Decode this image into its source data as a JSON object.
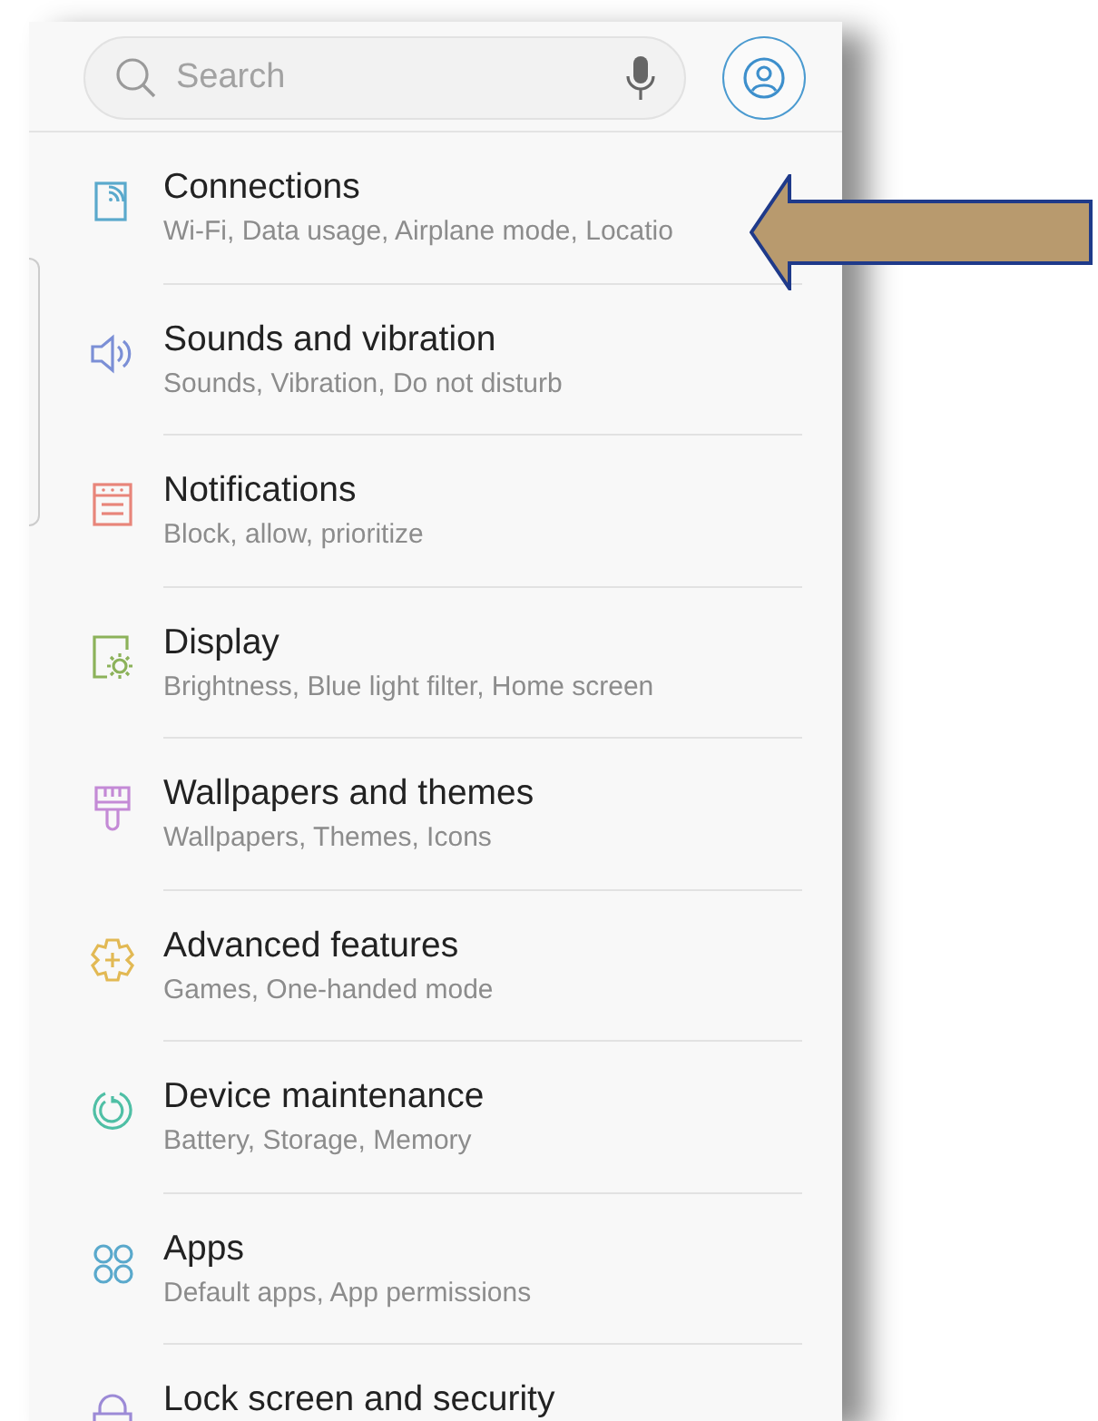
{
  "search": {
    "placeholder": "Search"
  },
  "items": [
    {
      "title": "Connections",
      "subtitle": "Wi-Fi, Data usage, Airplane mode, Locatio",
      "kind": "connections",
      "color": "#5aa9cc"
    },
    {
      "title": "Sounds and vibration",
      "subtitle": "Sounds, Vibration, Do not disturb",
      "kind": "sound",
      "color": "#7b8fd6"
    },
    {
      "title": "Notifications",
      "subtitle": "Block, allow, prioritize",
      "kind": "notifications",
      "color": "#e8857a"
    },
    {
      "title": "Display",
      "subtitle": "Brightness, Blue light filter, Home screen",
      "kind": "display",
      "color": "#8cb25a"
    },
    {
      "title": "Wallpapers and themes",
      "subtitle": "Wallpapers, Themes, Icons",
      "kind": "wallpaper",
      "color": "#c48ad6"
    },
    {
      "title": "Advanced features",
      "subtitle": "Games, One-handed mode",
      "kind": "advanced",
      "color": "#e2b954"
    },
    {
      "title": "Device maintenance",
      "subtitle": "Battery, Storage, Memory",
      "kind": "maintenance",
      "color": "#4fbfa5"
    },
    {
      "title": "Apps",
      "subtitle": "Default apps, App permissions",
      "kind": "apps",
      "color": "#5aa9cc"
    },
    {
      "title": "Lock screen and security",
      "kind": "lock",
      "color": "#9c8ad6"
    }
  ]
}
